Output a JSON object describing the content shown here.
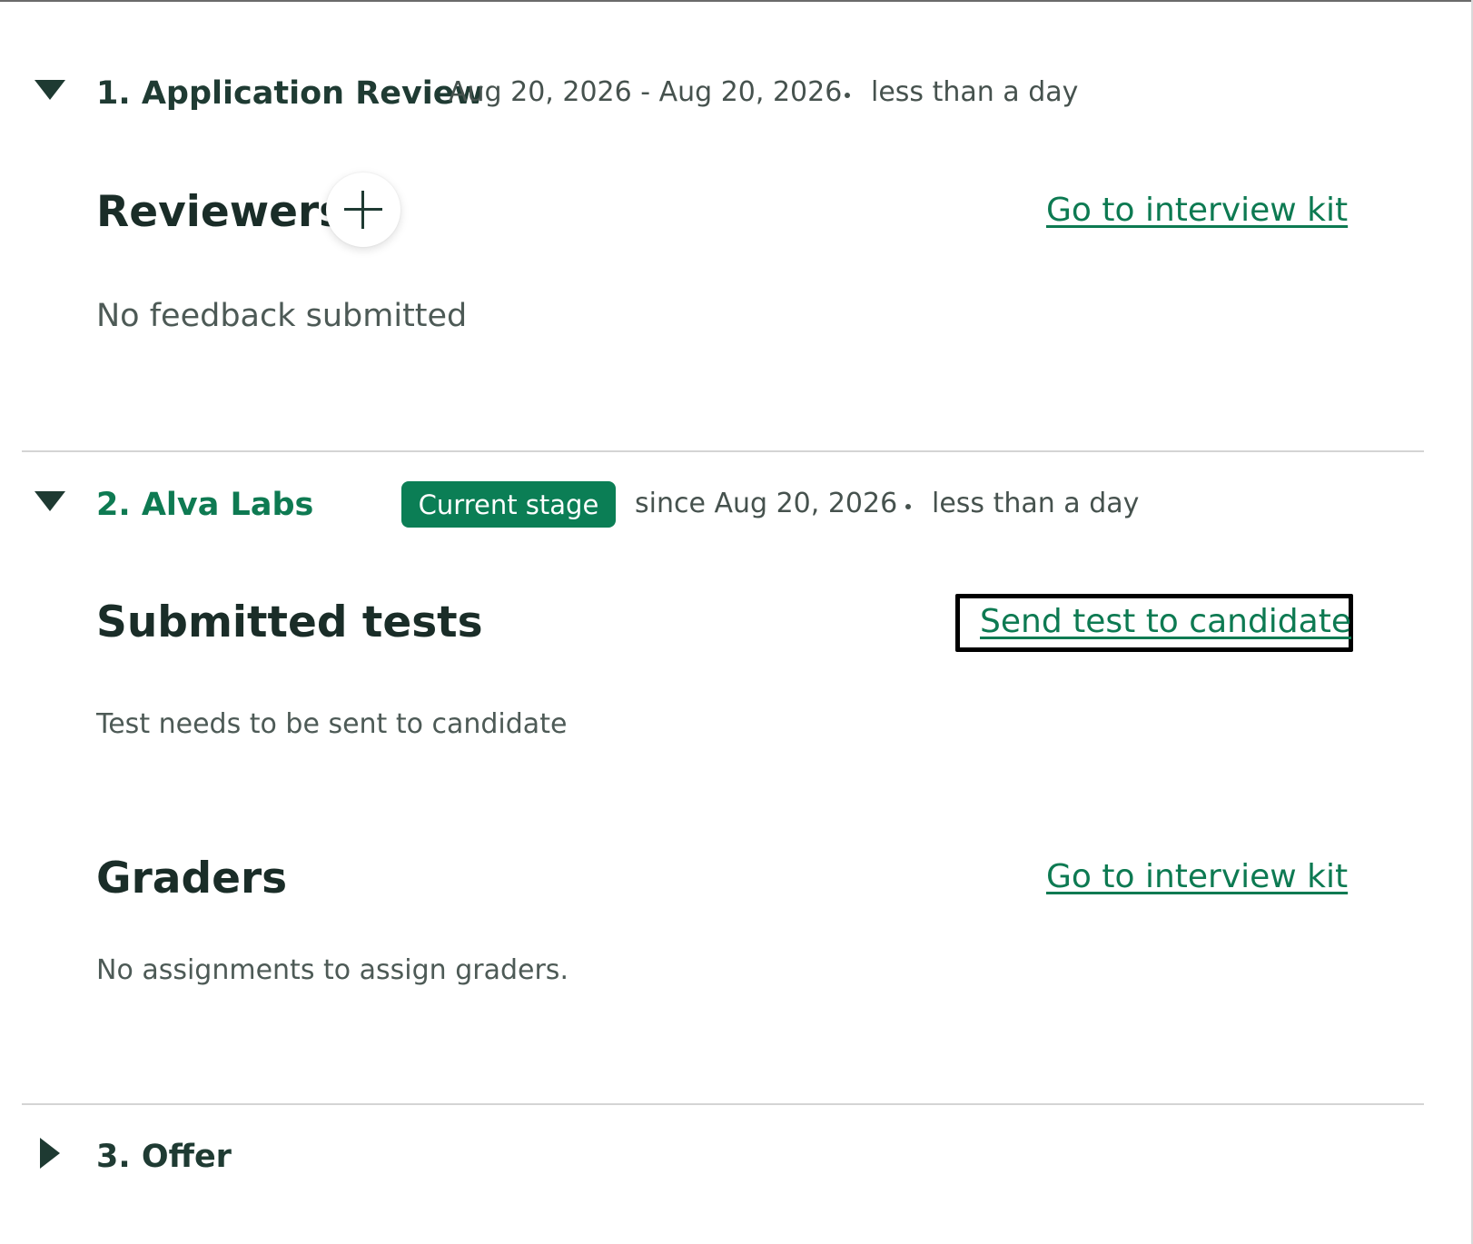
{
  "stages": [
    {
      "title": "1. Application Review",
      "date_range": "Aug 20, 2026 - Aug 20, 2026",
      "duration": "less than a day",
      "expanded": true,
      "sections": {
        "reviewers": {
          "title": "Reviewers",
          "add_icon": "plus-icon",
          "link": "Go to interview kit",
          "empty": "No feedback submitted"
        }
      }
    },
    {
      "title": "2. Alva Labs",
      "badge": "Current stage",
      "since": "since Aug 20, 2026",
      "duration": "less than a day",
      "expanded": true,
      "sections": {
        "submitted_tests": {
          "title": "Submitted tests",
          "link": "Send test to candidate",
          "empty": "Test needs to be sent to candidate"
        },
        "graders": {
          "title": "Graders",
          "link": "Go to interview kit",
          "empty": "No assignments to assign graders."
        }
      }
    },
    {
      "title": "3. Offer",
      "expanded": false
    }
  ],
  "colors": {
    "accent": "#0b7e55",
    "text_dark": "#1a2d28",
    "text_muted": "#46524e",
    "divider": "#d4d4d4"
  },
  "icons": {
    "expanded": "caret-down-icon",
    "collapsed": "caret-right-icon"
  }
}
